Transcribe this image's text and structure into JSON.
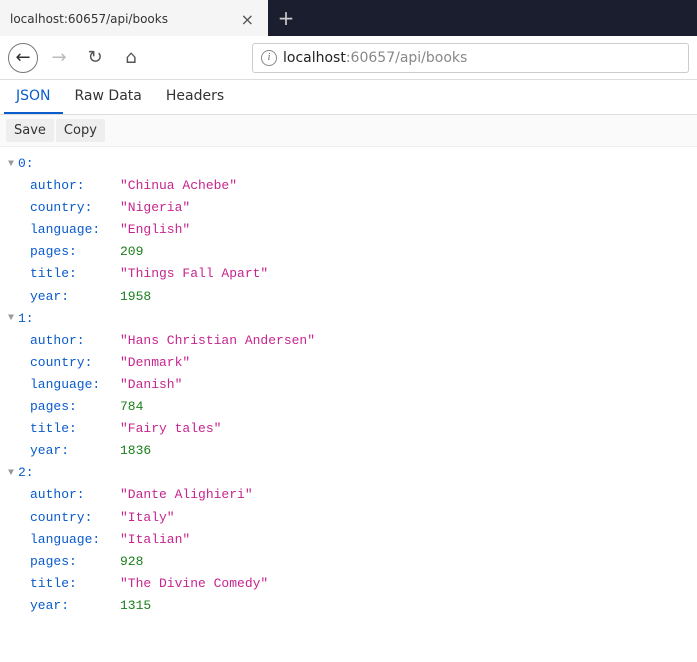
{
  "titlebar": {
    "tab_title": "localhost:60657/api/books",
    "close_glyph": "×",
    "newtab_glyph": "+"
  },
  "toolbar": {
    "back_glyph": "←",
    "forward_glyph": "→",
    "reload_glyph": "↻",
    "home_glyph": "⌂",
    "info_glyph": "i",
    "url_host": "localhost",
    "url_rest": ":60657/api/books"
  },
  "view_tabs": {
    "json": "JSON",
    "raw": "Raw Data",
    "headers": "Headers"
  },
  "actions": {
    "save": "Save",
    "copy": "Copy"
  },
  "json_keys": {
    "author": "author:",
    "country": "country:",
    "language": "language:",
    "pages": "pages:",
    "title": "title:",
    "year": "year:"
  },
  "json_data": [
    {
      "index": "0:",
      "author": "\"Chinua Achebe\"",
      "country": "\"Nigeria\"",
      "language": "\"English\"",
      "pages": "209",
      "title": "\"Things Fall Apart\"",
      "year": "1958"
    },
    {
      "index": "1:",
      "author": "\"Hans Christian Andersen\"",
      "country": "\"Denmark\"",
      "language": "\"Danish\"",
      "pages": "784",
      "title": "\"Fairy tales\"",
      "year": "1836"
    },
    {
      "index": "2:",
      "author": "\"Dante Alighieri\"",
      "country": "\"Italy\"",
      "language": "\"Italian\"",
      "pages": "928",
      "title": "\"The Divine Comedy\"",
      "year": "1315"
    }
  ]
}
